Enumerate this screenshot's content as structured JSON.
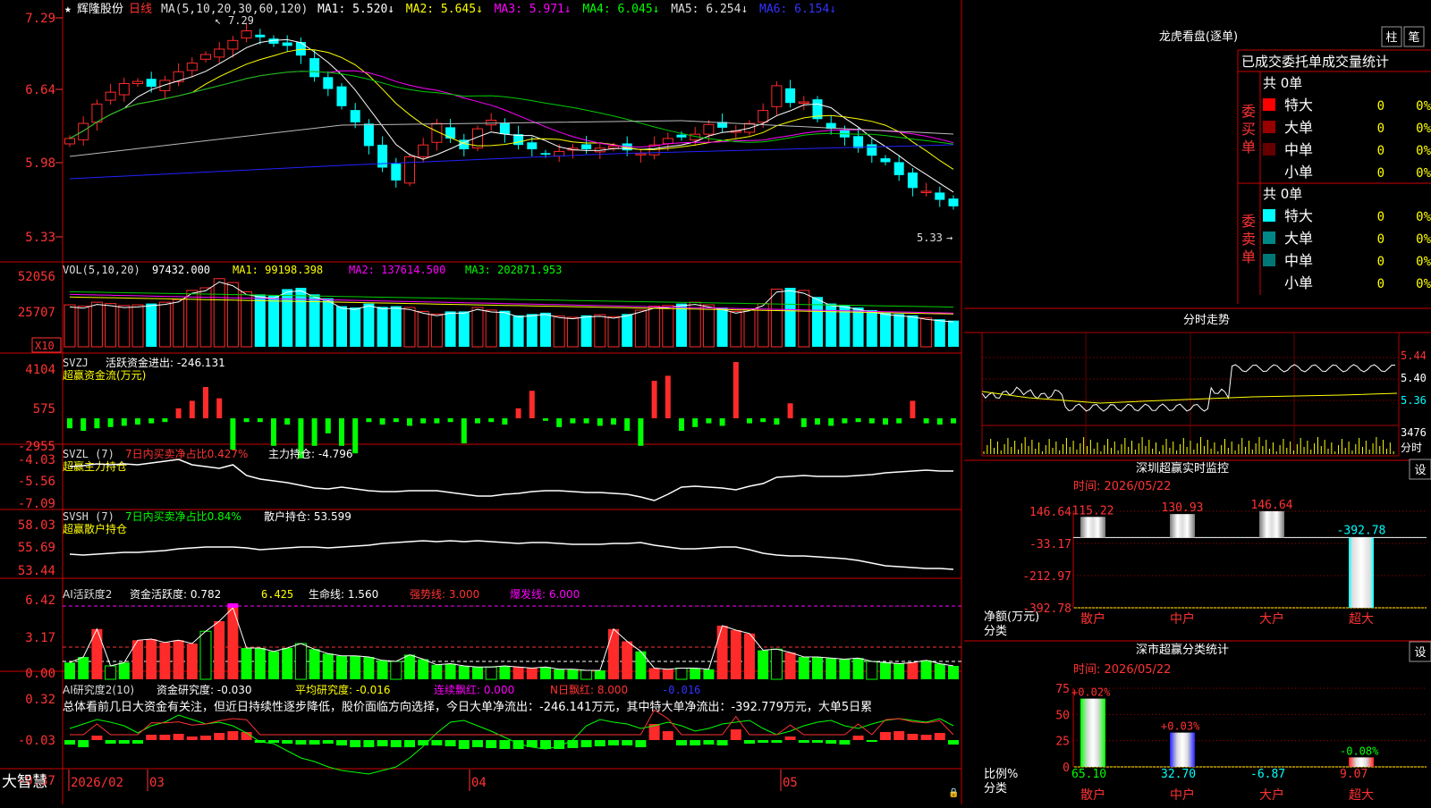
{
  "app": {
    "brand": "大智慧"
  },
  "stock": {
    "name": "辉隆股份",
    "period": "日线"
  },
  "colors": {
    "up": "#ff2a2a",
    "down": "#00ffff",
    "vol_down": "#00ffff",
    "green": "#00ff00",
    "white": "#ffffff",
    "yellow": "#ffff00",
    "magenta": "#ff00ff",
    "frame": "#cc0000"
  },
  "price_panel": {
    "ma_label": "MA(5,10,20,30,60,120)",
    "ma_values": [
      {
        "name": "MA1",
        "value": "5.520",
        "color": "#ffffff"
      },
      {
        "name": "MA2",
        "value": "5.645",
        "color": "#ffff00"
      },
      {
        "name": "MA3",
        "value": "5.971",
        "color": "#ff00ff"
      },
      {
        "name": "MA4",
        "value": "6.045",
        "color": "#00ff00"
      },
      {
        "name": "MA5",
        "value": "6.254",
        "color": "#dddddd"
      },
      {
        "name": "MA6",
        "value": "6.154",
        "color": "#3333ff"
      }
    ],
    "y_ticks": [
      "7.29",
      "6.64",
      "5.98",
      "5.33"
    ],
    "high_label": "7.29",
    "low_label": "5.33"
  },
  "vol_panel": {
    "label": "VOL(5,10,20)",
    "value": "97432.000",
    "ma1": "MA1: 99198.398",
    "ma2": "MA2: 137614.500",
    "ma3": "MA3: 202871.953",
    "y_ticks": [
      "52056",
      "25707"
    ],
    "unit": "X10"
  },
  "svzj_panel": {
    "label": "SVZJ",
    "value": "活跃资金进出: -246.131",
    "sub": "超赢资金流(万元)",
    "y_ticks": [
      "4104",
      "575",
      "-2955"
    ]
  },
  "svzl_panel": {
    "label": "SVZL (7)",
    "pct": "7日内买卖净占比0.427%",
    "value": "主力持仓: -4.796",
    "sub": "超赢主力持仓",
    "y_ticks": [
      "-4.03",
      "-5.56",
      "-7.09"
    ]
  },
  "svsh_panel": {
    "label": "SVSH (7)",
    "pct": "7日内买卖净占比0.84%",
    "value": "散户持仓: 53.599",
    "sub": "超赢散户持仓",
    "y_ticks": [
      "58.03",
      "55.69",
      "53.44"
    ]
  },
  "ai_panel": {
    "label": "AI活跃度2",
    "value": "资金活跃度: 0.782",
    "v2": "6.425",
    "life": "生命线: 1.560",
    "strong": "强势线: 3.000",
    "burst": "爆发线: 6.000",
    "y_ticks": [
      "6.42",
      "3.17",
      "0.00"
    ]
  },
  "research_panel": {
    "label": "AI研究度2(10)",
    "value": "资金研究度: -0.030",
    "avg": "平均研究度: -0.016",
    "cont": "连续飘红: 0.000",
    "ndays": "N日飘红: 8.000",
    "last": "-0.016",
    "y_ticks": [
      "0.32",
      "-0.03",
      "-0.37"
    ],
    "summary": "总体看前几日大资金有关注，但近日持续性逐步降低，股价面临方向选择，今日大单净流出：-246.141万元，其中特大单净流出：-392.779万元，大单5日累"
  },
  "x_axis": {
    "labels": [
      "2026/02",
      "03",
      "04",
      "05"
    ]
  },
  "longhu": {
    "title": "龙虎看盘(逐单)",
    "btn_bar": "柱",
    "btn_pen": "笔",
    "header": "已成交委托单成交量统计",
    "buy_label": "委买单",
    "sell_label": "委卖单",
    "buy_total": "共 0单",
    "sell_total": "共 0单",
    "buy_rows": [
      {
        "name": "特大",
        "count": "0",
        "pct": "0%",
        "color": "#ff0000"
      },
      {
        "name": "大单",
        "count": "0",
        "pct": "0%",
        "color": "#990000"
      },
      {
        "name": "中单",
        "count": "0",
        "pct": "0%",
        "color": "#660000"
      },
      {
        "name": "小单",
        "count": "0",
        "pct": "0%",
        "color": ""
      }
    ],
    "sell_rows": [
      {
        "name": "特大",
        "count": "0",
        "pct": "0%",
        "color": "#00ffff"
      },
      {
        "name": "大单",
        "count": "0",
        "pct": "0%",
        "color": "#008888"
      },
      {
        "name": "中单",
        "count": "0",
        "pct": "0%",
        "color": "#007777"
      },
      {
        "name": "小单",
        "count": "0",
        "pct": "0%",
        "color": ""
      }
    ]
  },
  "intraday": {
    "title": "分时走势",
    "y_ticks": [
      "5.44",
      "5.40",
      "5.36"
    ],
    "vol_tick": "3476",
    "vol_unit": "分时"
  },
  "monitor": {
    "title": "深圳超赢实时监控",
    "set_btn": "设",
    "time": "时间: 2026/05/22",
    "y_ticks": [
      "146.64",
      "-33.17",
      "-212.97",
      "-392.78"
    ],
    "y_unit": "净额(万元)",
    "x_unit": "分类"
  },
  "classify": {
    "title": "深市超赢分类统计",
    "set_btn": "设",
    "time": "时间: 2026/05/22",
    "y_ticks": [
      "75",
      "50",
      "25",
      "0"
    ],
    "y_unit": "比例%",
    "x_unit": "分类"
  },
  "chart_data": [
    {
      "type": "bar",
      "title": "深圳超赢实时监控",
      "categories": [
        "散户",
        "中户",
        "大户",
        "超大"
      ],
      "values": [
        115.22,
        130.93,
        146.64,
        -392.78
      ],
      "ylabel": "净额(万元)",
      "ylim": [
        -392.78,
        146.64
      ]
    },
    {
      "type": "bar",
      "title": "深市超赢分类统计",
      "categories": [
        "散户",
        "中户",
        "大户",
        "超大"
      ],
      "values": [
        65.1,
        32.7,
        -6.87,
        9.07
      ],
      "changes": [
        "+0.02%",
        "+0.03%",
        "",
        "-0.08%"
      ],
      "ylabel": "比例%",
      "ylim": [
        0,
        75
      ]
    }
  ]
}
